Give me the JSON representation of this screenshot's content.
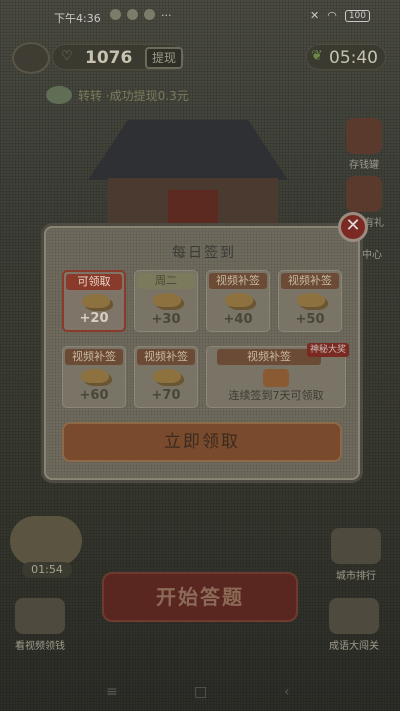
{
  "status_bar": {
    "time": "下午4:36",
    "more": "···",
    "battery": "100"
  },
  "top_bar": {
    "coins": "1076",
    "withdraw_label": "提现",
    "timer": "05:40"
  },
  "ticker": {
    "text": "转转  ·成功提现0.3元"
  },
  "side_icons": [
    {
      "label": "存钱罐",
      "icon": "piggy-bank-icon"
    },
    {
      "label": "签到有礼",
      "icon": "sword-icon"
    },
    {
      "label": "中心",
      "icon": "center-icon"
    }
  ],
  "dialog": {
    "title": "每日签到",
    "days": [
      {
        "header": "可领取",
        "reward": "+20",
        "state": "active"
      },
      {
        "header": "周二",
        "reward": "+30",
        "state": "today"
      },
      {
        "header": "视频补签",
        "reward": "+40",
        "state": "normal"
      },
      {
        "header": "视频补签",
        "reward": "+50",
        "state": "normal"
      },
      {
        "header": "视频补签",
        "reward": "+60",
        "state": "normal"
      },
      {
        "header": "视频补签",
        "reward": "+70",
        "state": "normal"
      }
    ],
    "big_card": {
      "header": "视频补签",
      "tag": "神秘大奖",
      "note": "连续签到7天可领取"
    },
    "claim_label": "立即领取",
    "close_symbol": "✕"
  },
  "bottom": {
    "tree_timer": "01:54",
    "start_label": "开始答题",
    "left_label": "看视频领钱",
    "right_top_label": "城市排行",
    "right_bottom_label": "成语大闯关"
  },
  "nav": {
    "menu": "≡",
    "home": "□",
    "back": "‹"
  }
}
